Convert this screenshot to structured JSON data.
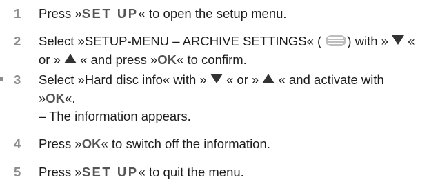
{
  "steps": [
    {
      "number": "1",
      "pre": "Press »",
      "key": "SET UP",
      "post": "« to open the setup menu."
    },
    {
      "number": "2",
      "line1_pre": "Select »SETUP-MENU – ARCHIVE SETTINGS« (",
      "line1_mid": ") with »",
      "line1_post": "«",
      "line2_pre": "or »",
      "line2_mid": "« and press »",
      "line2_key": "OK",
      "line2_post": "« to confirm."
    },
    {
      "number": "3",
      "line1_pre": "Select »Hard disc info« with »",
      "line1_mid": "« or »",
      "line1_post": "« and activate with",
      "line2_pre": "»",
      "line2_key": "OK",
      "line2_post": "«.",
      "line3": "– The information appears."
    },
    {
      "number": "4",
      "pre": "Press »",
      "key": "OK",
      "post": "« to switch off the information."
    },
    {
      "number": "5",
      "pre": "Press »",
      "key": "SET UP",
      "post": "« to quit the menu."
    }
  ],
  "icons": {
    "archive": "archive-settings-icon",
    "down": "down-arrow-icon",
    "up": "up-arrow-icon"
  }
}
